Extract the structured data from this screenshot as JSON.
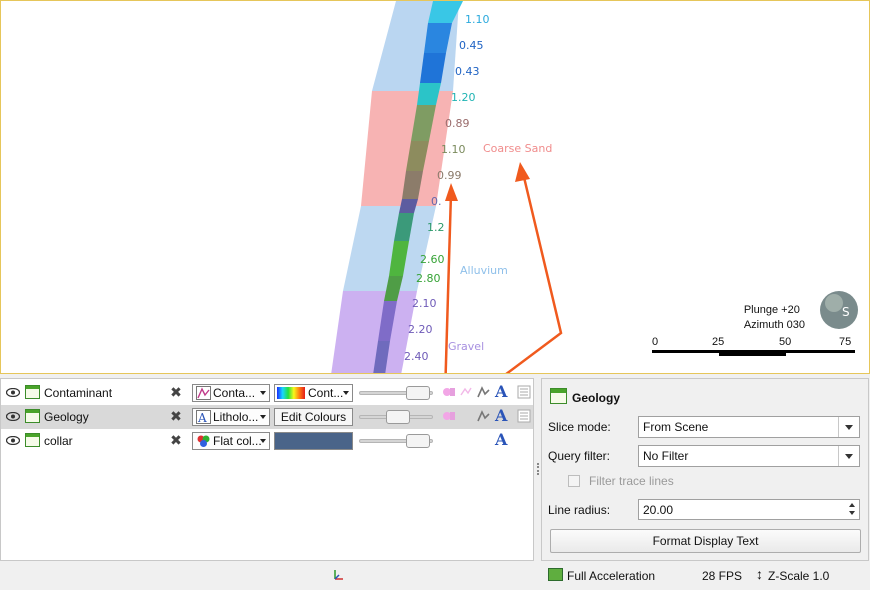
{
  "scene": {
    "segments_values": [
      "1.10",
      "0.45",
      "0.43",
      "1.20",
      "0.89",
      "1.10",
      "0.99",
      "0.",
      "1.2",
      "2.60",
      "2.80",
      "2.10",
      "2.20",
      "2.40"
    ],
    "labels": {
      "coarse_sand": "Coarse Sand",
      "alluvium": "Alluvium",
      "gravel": "Gravel"
    },
    "compass": {
      "plunge": "Plunge +20",
      "azimuth": "Azimuth 030",
      "letter": "S"
    },
    "scale": {
      "ticks": [
        "0",
        "25",
        "50",
        "75"
      ]
    },
    "colors": {
      "coarse_sand": "#f4a9a9",
      "alluvium": "#a9cfef",
      "gravel": "#c3a9ef",
      "arrow": "#f05a1e"
    }
  },
  "layers": [
    {
      "name": "Contaminant",
      "mode": "Conta...",
      "colour": "Cont...",
      "colour_type": "rainbow"
    },
    {
      "name": "Geology",
      "mode": "Litholo...",
      "colour": "Edit Colours",
      "colour_type": "button",
      "selected": true
    },
    {
      "name": "collar",
      "mode": "Flat col...",
      "colour": "",
      "colour_type": "solid"
    }
  ],
  "props": {
    "title": "Geology",
    "slice_mode_label": "Slice mode:",
    "slice_mode_value": "From Scene",
    "query_filter_label": "Query filter:",
    "query_filter_value": "No Filter",
    "filter_trace_label": "Filter trace lines",
    "line_radius_label": "Line radius:",
    "line_radius_value": "20.00",
    "format_button": "Format Display Text"
  },
  "status": {
    "acceleration": "Full Acceleration",
    "fps": "28 FPS",
    "zscale": "Z-Scale 1.0"
  }
}
